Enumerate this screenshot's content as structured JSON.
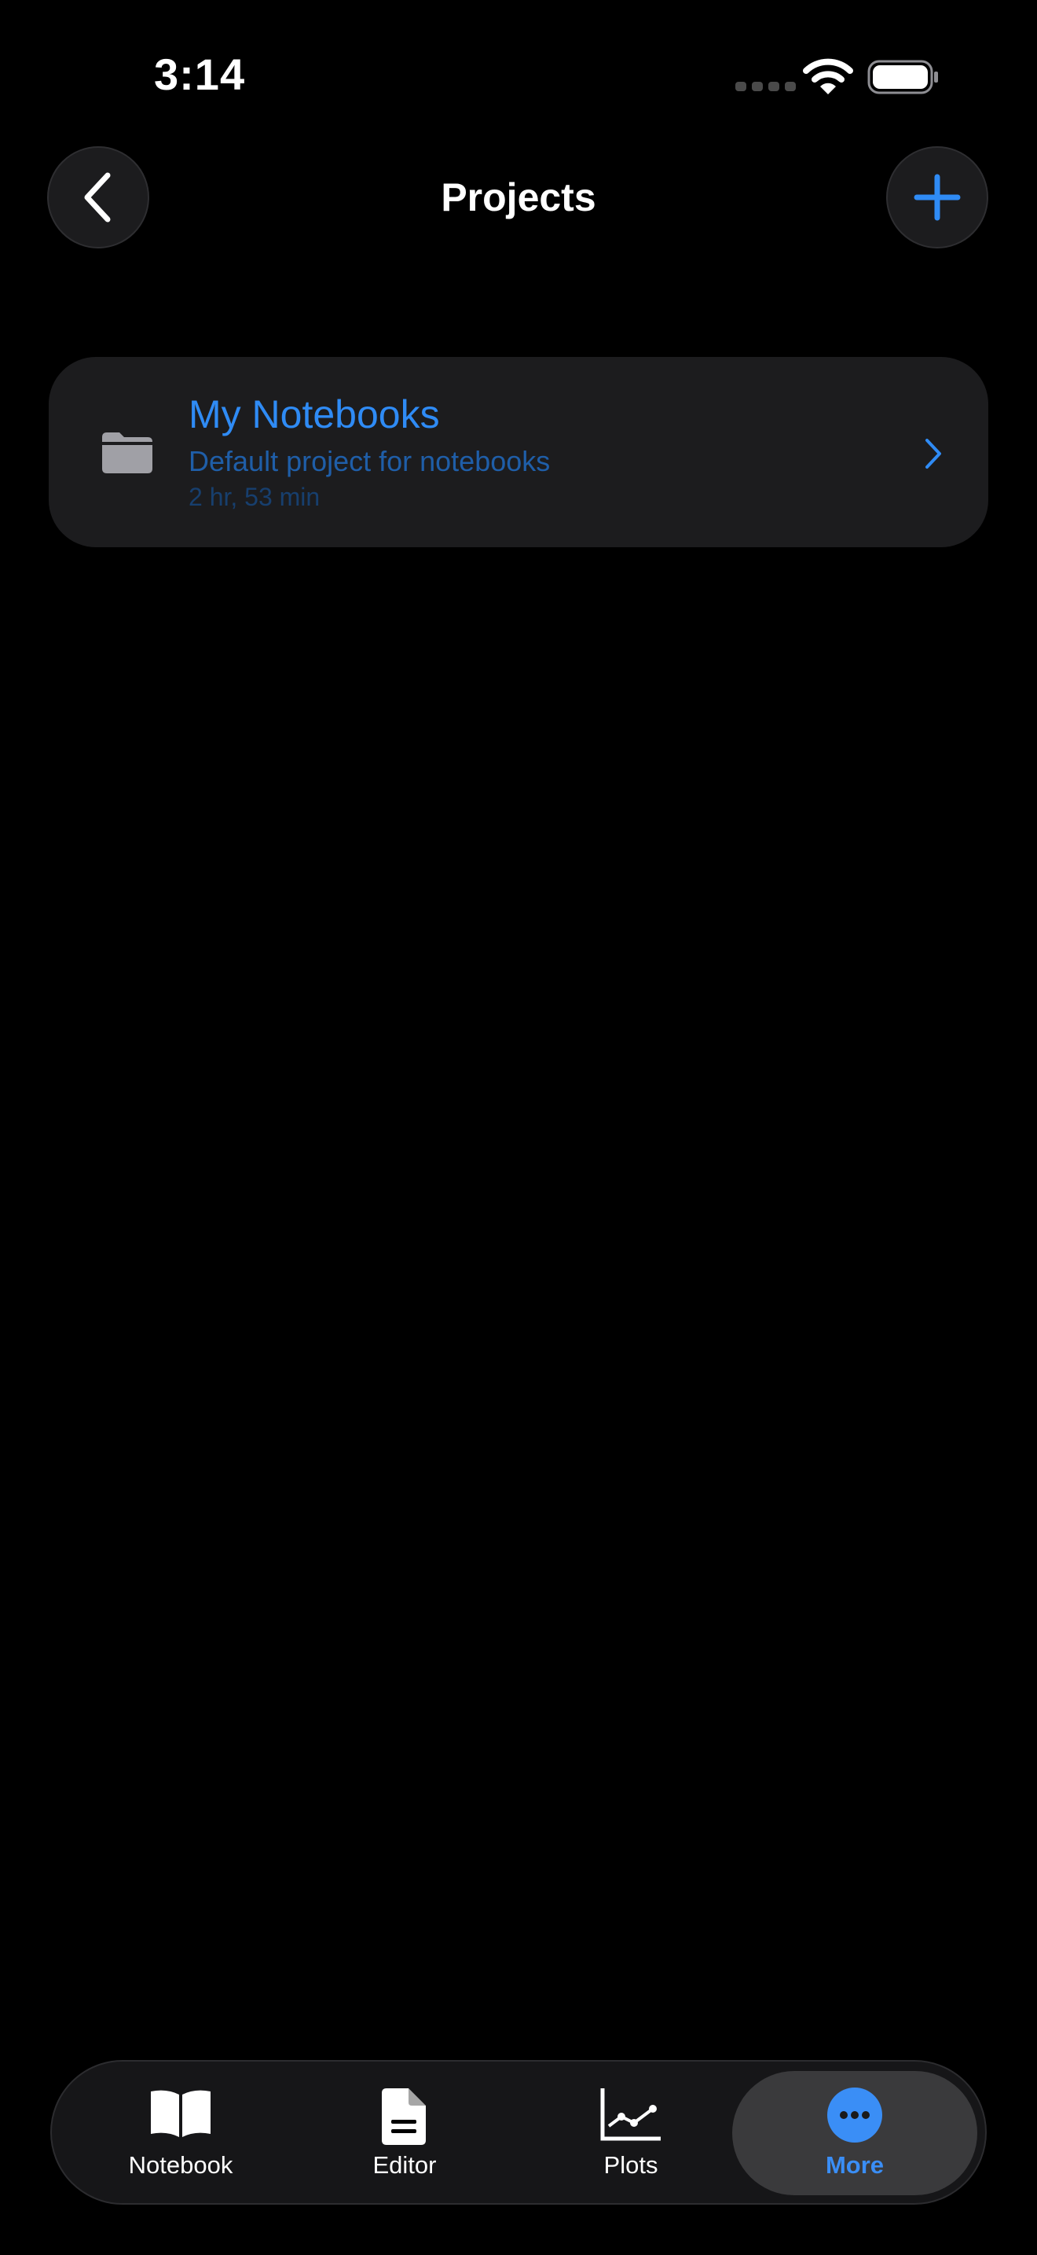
{
  "status_bar": {
    "time": "3:14"
  },
  "nav": {
    "title": "Projects"
  },
  "projects": [
    {
      "name": "My Notebooks",
      "description": "Default project for notebooks",
      "duration": "2 hr, 53 min"
    }
  ],
  "tabs": [
    {
      "label": "Notebook",
      "icon": "book-icon"
    },
    {
      "label": "Editor",
      "icon": "document-icon"
    },
    {
      "label": "Plots",
      "icon": "chart-icon"
    },
    {
      "label": "More",
      "icon": "ellipsis-circle-icon",
      "selected": true
    }
  ],
  "colors": {
    "accent": "#2f8bf5",
    "background": "#000000",
    "card": "#1c1c1e"
  }
}
